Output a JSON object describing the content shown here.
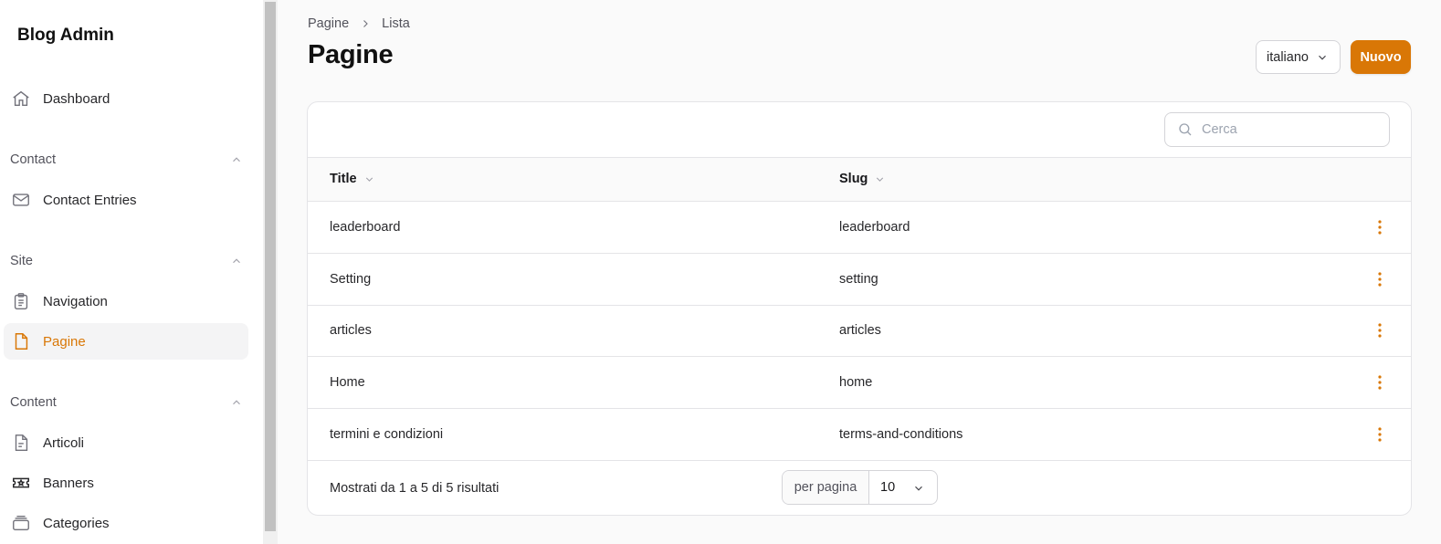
{
  "sidebar": {
    "brand": "Blog Admin",
    "dashboard": "Dashboard",
    "groups": [
      {
        "label": "Contact",
        "items": [
          "Contact Entries"
        ]
      },
      {
        "label": "Site",
        "items": [
          "Navigation",
          "Pagine"
        ]
      },
      {
        "label": "Content",
        "items": [
          "Articoli",
          "Banners",
          "Categories"
        ]
      }
    ],
    "active_item": "Pagine",
    "accent_color": "#d97706"
  },
  "breadcrumb": {
    "items": [
      "Pagine",
      "Lista"
    ]
  },
  "page_title": "Pagine",
  "header": {
    "language": "italiano",
    "new_button": "Nuovo"
  },
  "search": {
    "placeholder": "Cerca",
    "value": ""
  },
  "table": {
    "columns": [
      "Title",
      "Slug"
    ],
    "rows": [
      {
        "title": "leaderboard",
        "slug": "leaderboard"
      },
      {
        "title": "Setting",
        "slug": "setting"
      },
      {
        "title": "articles",
        "slug": "articles"
      },
      {
        "title": "Home",
        "slug": "home"
      },
      {
        "title": "termini e condizioni",
        "slug": "terms-and-conditions"
      }
    ]
  },
  "footer": {
    "results_text": "Mostrati da 1 a 5 di 5 risultati",
    "per_page_label": "per pagina",
    "per_page_value": "10"
  }
}
